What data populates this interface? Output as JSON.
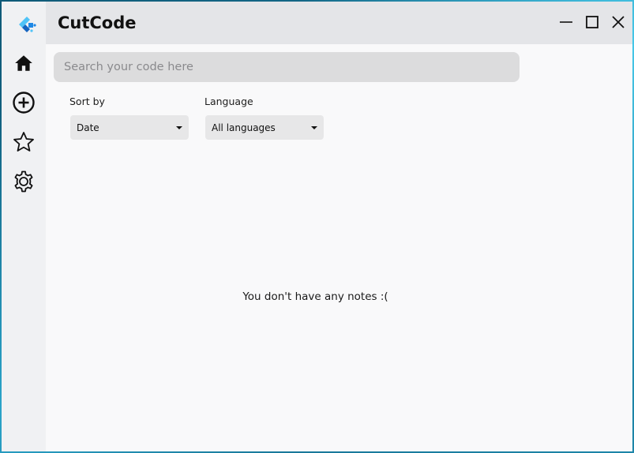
{
  "app": {
    "title": "CutCode"
  },
  "search": {
    "placeholder": "Search your code here",
    "value": ""
  },
  "filters": {
    "sort": {
      "label": "Sort by",
      "selected": "Date"
    },
    "language": {
      "label": "Language",
      "selected": "All languages"
    }
  },
  "sidebar": {
    "items": [
      {
        "name": "home",
        "icon": "home-icon"
      },
      {
        "name": "add",
        "icon": "plus-circle-icon"
      },
      {
        "name": "favorites",
        "icon": "star-icon"
      },
      {
        "name": "settings",
        "icon": "gear-icon"
      }
    ]
  },
  "main": {
    "empty_message": "You don't have any notes :("
  },
  "colors": {
    "sidebar_bg": "#f0f1f3",
    "titlebar_bg": "#e4e5e8",
    "content_bg": "#f9f9fa",
    "logo_blue": "#1e88e5"
  }
}
